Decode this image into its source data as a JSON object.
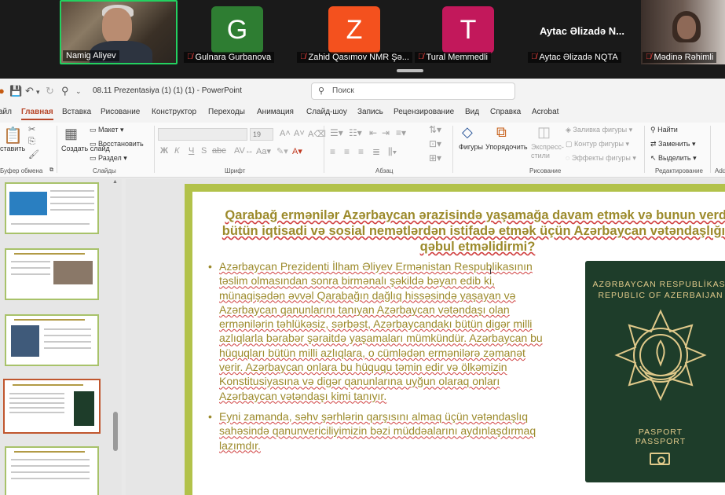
{
  "meeting": {
    "participants": [
      {
        "name": "Namig Aliyev",
        "type": "video",
        "muted": false,
        "active": true
      },
      {
        "name": "Gulnara Gurbanova",
        "initial": "G",
        "color": "#2e7d32",
        "muted": true
      },
      {
        "name": "Zahid Qasımov NMR Şə...",
        "initial": "Z",
        "color": "#f4511e",
        "muted": true
      },
      {
        "name": "Tural Memmedli",
        "initial": "T",
        "color": "#c2185b",
        "muted": true
      },
      {
        "name": "Aytac Əlizadə NQTA",
        "big_name": "Aytac Əlizadə N...",
        "muted": true
      },
      {
        "name": "Mədinə Rəhimli",
        "type": "video",
        "muted": true
      }
    ]
  },
  "app": {
    "doc_title": "08.11 Prezentasiya (1) (1) (1)  -  PowerPoint",
    "search_placeholder": "Поиск",
    "tabs": [
      "айл",
      "Главная",
      "Вставка",
      "Рисование",
      "Конструктор",
      "Переходы",
      "Анимация",
      "Слайд-шоу",
      "Запись",
      "Рецензирование",
      "Вид",
      "Справка",
      "Acrobat"
    ],
    "selected_tab": "Главная"
  },
  "ribbon": {
    "paste": "ставить",
    "create_slide": "Создать слайд",
    "layout": "Макет",
    "restore": "Восстановить",
    "section": "Раздел",
    "font_size": "19",
    "shapes": "Фигуры",
    "arrange": "Упорядочить",
    "express_styles": "Экспресс-стили",
    "shape_fill": "Заливка фигуры",
    "shape_outline": "Контур фигуры",
    "shape_effects": "Эффекты фигуры",
    "find": "Найти",
    "replace": "Заменить",
    "select": "Выделить",
    "groups": {
      "clipboard": "Буфер обмена",
      "slides": "Слайды",
      "font": "Шрифт",
      "paragraph": "Абзац",
      "drawing": "Рисование",
      "editing": "Редактирование",
      "add": "Add"
    }
  },
  "slide": {
    "title": "Qarabağ ermənilər Azərbaycan ərazisində yaşamağa davam etmək və bunun verdi bütün iqtisadi və sosial nemətlərdən istifadə etmək üçün Azərbaycan vətəndaşlığın qəbul etməlidirmi?",
    "bullets": [
      "Azərbaycan Prezidenti İlham Əliyev Ermənistan Respublikasının təslim olmasından sonra birmənalı şəkildə bəyan edib ki, münaqişədən əvvəl Qarabağın dağlıq hissəsində yaşayan və Azərbaycan qanunlarını tanıyan Azərbaycan vətəndaşı olan ermənilərin təhlükəsiz, sərbəst, Azərbaycandakı bütün digər milli azlıqlarla bərabər şəraitdə yaşamaları mümkündür. Azərbaycan bu hüquqları bütün milli azlıqlara, o cümlədən ermənilərə zəmanət verir. Azərbaycan onlara bu hüququ təmin edir və ölkəmizin Konstitusiyasına və digər qanunlarına uyğun olaraq onları Azərbaycan vətəndaşı kimi tanıyır.",
      "Eyni zamanda, səhv şərhlərin qarşısını almaq üçün vətəndaşlıq sahəsində qanunvericiliyimizin bəzi müddəalarını aydınlaşdırmaq lazımdır."
    ],
    "passport": {
      "line1": "AZƏRBAYCAN RESPUBLİKASI",
      "line2": "REPUBLIC OF AZERBAIJAN",
      "label1": "PASPORT",
      "label2": "PASSPORT"
    }
  },
  "colors": {
    "accent": "#b7472a",
    "slide_text": "#9c8a2b",
    "slide_border": "#b2c24a",
    "passport": "#1e3d2a"
  }
}
